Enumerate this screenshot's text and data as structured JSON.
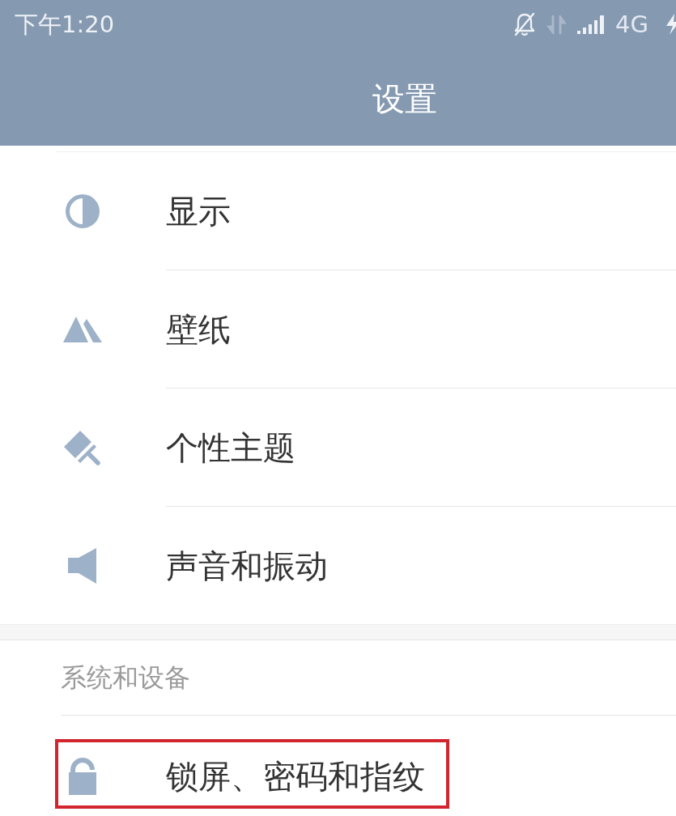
{
  "status_bar": {
    "time": "下午1:20",
    "network": "4G"
  },
  "title": "设置",
  "sections": [
    {
      "items": [
        {
          "label": "显示",
          "highlighted": false
        },
        {
          "label": "壁纸",
          "highlighted": false
        },
        {
          "label": "个性主题",
          "highlighted": false
        },
        {
          "label": "声音和振动",
          "highlighted": false
        }
      ]
    },
    {
      "header": "系统和设备",
      "items": [
        {
          "label": "锁屏、密码和指纹",
          "highlighted": true
        }
      ]
    }
  ]
}
